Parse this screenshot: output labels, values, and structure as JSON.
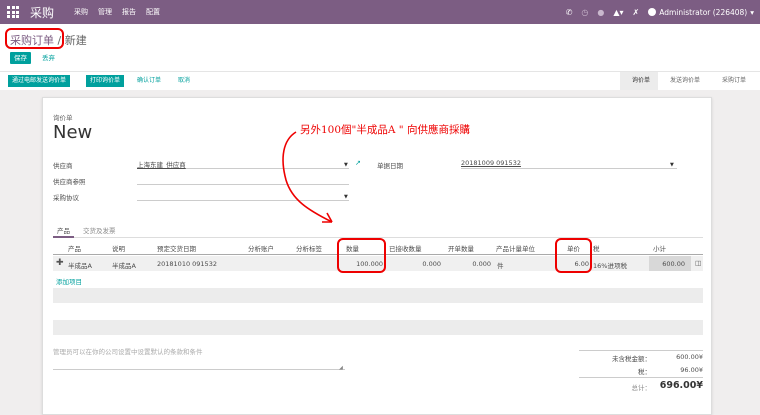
{
  "nav": {
    "app_title": "采购",
    "menu": [
      "采购",
      "管理",
      "报告",
      "配置"
    ],
    "user": "Administrator (226408)"
  },
  "control": {
    "breadcrumb_parent": "采购订单",
    "breadcrumb_sep": "/",
    "breadcrumb_current": "新建",
    "save_label": "保存",
    "discard_label": "丢弃"
  },
  "statusbar": {
    "email_rfq": "通过电邮发送询价单",
    "print_rfq": "打印询价单",
    "confirm_order": "确认订单",
    "cancel": "取消",
    "stages": [
      "询价单",
      "发送询价单",
      "采购订单"
    ]
  },
  "form": {
    "doc_type": "询价单",
    "doc_name": "New",
    "vendor_label": "供应商",
    "vendor_value": "上海东建_供应商",
    "vendor_ref_label": "供应商参照",
    "agreement_label": "采购协议",
    "order_date_label": "单据日期",
    "order_date_value": "20181009 091532"
  },
  "annotation": "另外100個\"半成品A \" 向供應商採購",
  "tabs": [
    "产品",
    "交货及发票"
  ],
  "table": {
    "headers": [
      "产品",
      "说明",
      "预定交货日期",
      "分析账户",
      "分析标签",
      "数量",
      "已接收数量",
      "开单数量",
      "产品计量单位",
      "单价",
      "税",
      "小计"
    ],
    "rows": [
      {
        "product": "半成品A",
        "description": "半成品A",
        "date_planned": "20181010 091532",
        "quantity": "100.000",
        "qty_received": "0.000",
        "qty_invoiced": "0.000",
        "uom": "件",
        "price_unit": "6.00",
        "tax": "16%进项税",
        "subtotal": "600.00"
      }
    ],
    "add_line": "添加项目"
  },
  "notes_placeholder": "管理员可以在你的公司设置中设置默认的条款和条件",
  "totals": {
    "untaxed_label": "未含税金额：",
    "untaxed_value": "600.00¥",
    "tax_label": "税：",
    "tax_value": "96.00¥",
    "total_label": "总计：",
    "total_value": "696.00¥"
  }
}
